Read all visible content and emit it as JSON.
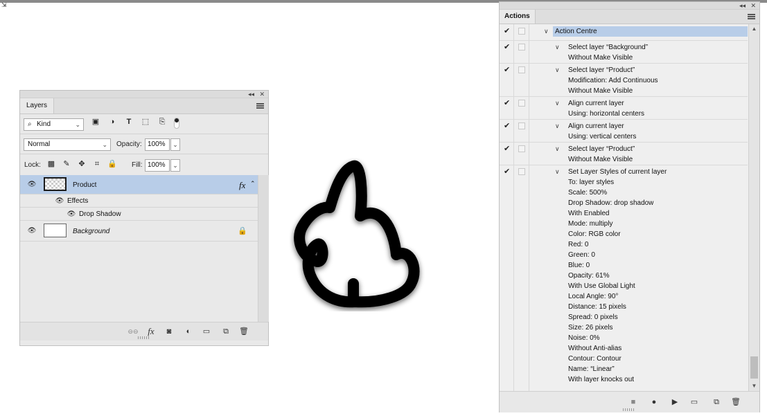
{
  "corner_icon": "resize-corner-icon",
  "layers_panel": {
    "strip_collapse": "◂◂",
    "strip_close": "✕",
    "tab_label": "Layers",
    "filter": {
      "kind_label": "Kind",
      "search_icon": "⌕",
      "filter_icons": [
        "▣",
        "◑",
        "T",
        "⬚",
        "⎘"
      ]
    },
    "blend_mode": "Normal",
    "opacity_label": "Opacity:",
    "opacity_value": "100%",
    "lock_label": "Lock:",
    "fill_label": "Fill:",
    "fill_value": "100%",
    "layers": [
      {
        "name": "Product",
        "fx": "fx",
        "selected": true
      },
      {
        "name": "Effects"
      },
      {
        "name": "Drop Shadow"
      },
      {
        "name": "Background"
      }
    ],
    "bottom_icons": {
      "link": "⊖⊖",
      "fx": "fx",
      "mask": "◙",
      "adjust": "◐",
      "folder": "▭",
      "new": "⧉",
      "trash": "🗑"
    }
  },
  "actions_panel": {
    "strip_collapse": "◂◂",
    "strip_close": "✕",
    "tab_label": "Actions",
    "steps": [
      {
        "label": "Action Centre",
        "level": 0,
        "check": "✔",
        "toggle": "∨",
        "selected": true
      },
      {
        "label": "Select layer “Background”",
        "level": 1,
        "check": "✔",
        "toggle": "∨"
      },
      {
        "label": "Without Make Visible",
        "level": 2
      },
      {
        "label": "Select layer “Product”",
        "level": 1,
        "check": "✔",
        "toggle": "∨"
      },
      {
        "label": "Modification: Add Continuous",
        "level": 2
      },
      {
        "label": "Without Make Visible",
        "level": 2
      },
      {
        "label": "Align current layer",
        "level": 1,
        "check": "✔",
        "toggle": "∨"
      },
      {
        "label": "Using: horizontal centers",
        "level": 2
      },
      {
        "label": "Align current layer",
        "level": 1,
        "check": "✔",
        "toggle": "∨"
      },
      {
        "label": "Using: vertical centers",
        "level": 2
      },
      {
        "label": "Select layer “Product”",
        "level": 1,
        "check": "✔",
        "toggle": "∨"
      },
      {
        "label": "Without Make Visible",
        "level": 2
      },
      {
        "label": "Set Layer Styles of current layer",
        "level": 1,
        "check": "✔",
        "toggle": "∨"
      },
      {
        "label": "To: layer styles",
        "level": 2
      },
      {
        "label": "Scale: 500%",
        "level": 2
      },
      {
        "label": "Drop Shadow: drop shadow",
        "level": 2
      },
      {
        "label": "With Enabled",
        "level": 2
      },
      {
        "label": "Mode: multiply",
        "level": 2
      },
      {
        "label": "Color: RGB color",
        "level": 2
      },
      {
        "label": "Red: 0",
        "level": 2
      },
      {
        "label": "Green: 0",
        "level": 2
      },
      {
        "label": "Blue: 0",
        "level": 2
      },
      {
        "label": "Opacity: 61%",
        "level": 2
      },
      {
        "label": "With Use Global Light",
        "level": 2
      },
      {
        "label": "Local Angle: 90°",
        "level": 2
      },
      {
        "label": "Distance: 15 pixels",
        "level": 2
      },
      {
        "label": "Spread: 0 pixels",
        "level": 2
      },
      {
        "label": "Size: 26 pixels",
        "level": 2
      },
      {
        "label": "Noise: 0%",
        "level": 2
      },
      {
        "label": "Without Anti-alias",
        "level": 2
      },
      {
        "label": "Contour: Contour",
        "level": 2
      },
      {
        "label": "Name:  “Linear”",
        "level": 2
      },
      {
        "label": "With layer knocks out",
        "level": 2
      }
    ],
    "bottom_icons": {
      "stop": "■",
      "record": "●",
      "play": "▶",
      "folder": "▭",
      "new": "⧉",
      "trash": "🗑"
    }
  },
  "colors": {
    "selection": "#b8cde8",
    "panel_bg": "#e9e9e9"
  }
}
